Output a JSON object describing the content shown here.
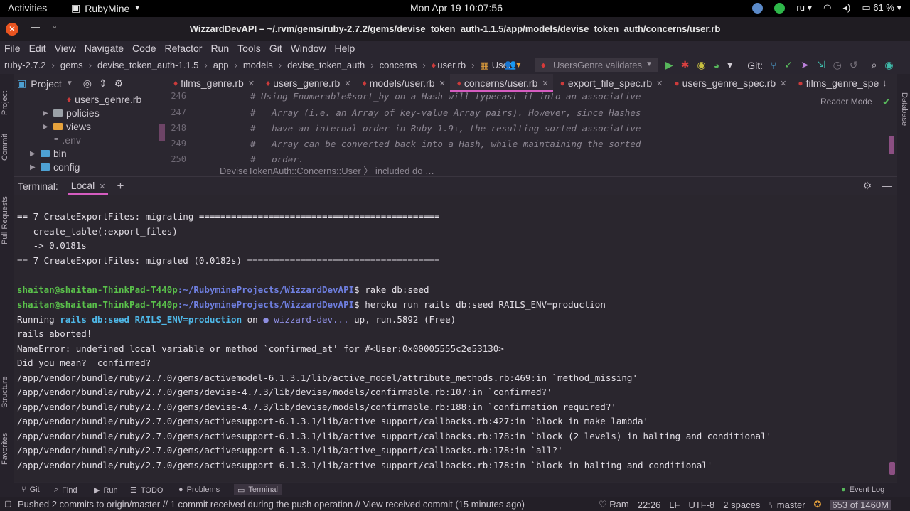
{
  "gnome": {
    "activities": "Activities",
    "app_name": "RubyMine",
    "clock": "Mon Apr 19  10:07:56",
    "keyboard": "ru",
    "battery": "61 %"
  },
  "window": {
    "title": "WizzardDevAPI – ~/.rvm/gems/ruby-2.7.2/gems/devise_token_auth-1.1.5/app/models/devise_token_auth/concerns/user.rb"
  },
  "menu": [
    "File",
    "Edit",
    "View",
    "Navigate",
    "Code",
    "Refactor",
    "Run",
    "Tools",
    "Git",
    "Window",
    "Help"
  ],
  "breadcrumbs": [
    "ruby-2.7.2",
    "gems",
    "devise_token_auth-1.1.5",
    "app",
    "models",
    "devise_token_auth",
    "concerns",
    "user.rb",
    "User"
  ],
  "run_config": "UsersGenre validates",
  "git_label": "Git:",
  "project": {
    "header": "Project",
    "tree": [
      {
        "label": "users_genre.rb",
        "kind": "ruby-file"
      },
      {
        "label": "policies",
        "kind": "folder"
      },
      {
        "label": "views",
        "kind": "folder"
      },
      {
        "label": ".env",
        "kind": "file"
      },
      {
        "label": "bin",
        "kind": "folder"
      },
      {
        "label": "config",
        "kind": "folder"
      }
    ]
  },
  "tabs": [
    {
      "label": "films_genre.rb"
    },
    {
      "label": "users_genre.rb"
    },
    {
      "label": "models/user.rb"
    },
    {
      "label": "concerns/user.rb",
      "active": true
    },
    {
      "label": "export_file_spec.rb"
    },
    {
      "label": "users_genre_spec.rb"
    },
    {
      "label": "films_genre_spe"
    }
  ],
  "editor": {
    "reader_mode": "Reader Mode",
    "lines": [
      {
        "num": "246",
        "text": "# Using Enumerable#sort_by on a Hash will typecast it into an associative"
      },
      {
        "num": "247",
        "text": "#   Array (i.e. an Array of key-value Array pairs). However, since Hashes"
      },
      {
        "num": "248",
        "text": "#   have an internal order in Ruby 1.9+, the resulting sorted associative"
      },
      {
        "num": "249",
        "text": "#   Array can be converted back into a Hash, while maintaining the sorted"
      },
      {
        "num": "250",
        "text": "#   order."
      }
    ],
    "breadcrumb": "DeviseTokenAuth::Concerns::User  〉 included do …"
  },
  "terminal": {
    "label": "Terminal:",
    "tab": "Local",
    "lines": [
      "== 7 CreateExportFiles: migrating =============================================",
      "-- create_table(:export_files)",
      "   -> 0.0181s",
      "== 7 CreateExportFiles: migrated (0.0182s) ====================================",
      "",
      "shaitan@shaitan-ThinkPad-T440p:~/RubymineProjects/WizzardDevAPI$ rake db:seed",
      "shaitan@shaitan-ThinkPad-T440p:~/RubymineProjects/WizzardDevAPI$ heroku run rails db:seed RAILS_ENV=production",
      "Running rails db:seed RAILS_ENV=production on ● wizzard-dev... up, run.5892 (Free)",
      "rails aborted!",
      "NameError: undefined local variable or method `confirmed_at' for #<User:0x00005555c2e53130>",
      "Did you mean?  confirmed?",
      "/app/vendor/bundle/ruby/2.7.0/gems/activemodel-6.1.3.1/lib/active_model/attribute_methods.rb:469:in `method_missing'",
      "/app/vendor/bundle/ruby/2.7.0/gems/devise-4.7.3/lib/devise/models/confirmable.rb:107:in `confirmed?'",
      "/app/vendor/bundle/ruby/2.7.0/gems/devise-4.7.3/lib/devise/models/confirmable.rb:188:in `confirmation_required?'",
      "/app/vendor/bundle/ruby/2.7.0/gems/activesupport-6.1.3.1/lib/active_support/callbacks.rb:427:in `block in make_lambda'",
      "/app/vendor/bundle/ruby/2.7.0/gems/activesupport-6.1.3.1/lib/active_support/callbacks.rb:178:in `block (2 levels) in halting_and_conditional'",
      "/app/vendor/bundle/ruby/2.7.0/gems/activesupport-6.1.3.1/lib/active_support/callbacks.rb:178:in `all?'",
      "/app/vendor/bundle/ruby/2.7.0/gems/activesupport-6.1.3.1/lib/active_support/callbacks.rb:178:in `block in halting_and_conditional'"
    ],
    "prompt_user": "shaitan@shaitan-ThinkPad-T440p",
    "prompt_path": ":~/RubymineProjects/WizzardDevAPI",
    "cmd1": "$ rake db:seed",
    "cmd2": "$ heroku run rails db:seed RAILS_ENV=production",
    "running_prefix": "Running ",
    "running_cmd": "rails db:seed RAILS_ENV=production",
    "running_on": " on ",
    "running_app": "● wizzard-dev...",
    "running_suffix": " up, run.5892 (Free)"
  },
  "left_tabs": [
    "Project",
    "Commit",
    "Pull Requests",
    "Structure",
    "Favorites"
  ],
  "right_tabs": [
    "Database"
  ],
  "bottom_tools": [
    "Git",
    "Find",
    "Run",
    "TODO",
    "Problems",
    "Terminal",
    "Event Log"
  ],
  "status": {
    "message": "Pushed 2 commits to origin/master // 1 commit received during the push operation // View received commit (15 minutes ago)",
    "ram": "Ram",
    "position": "22:26",
    "line_sep": "LF",
    "encoding": "UTF-8",
    "indent": "2 spaces",
    "branch": "master",
    "memory": "653 of 1460M"
  }
}
